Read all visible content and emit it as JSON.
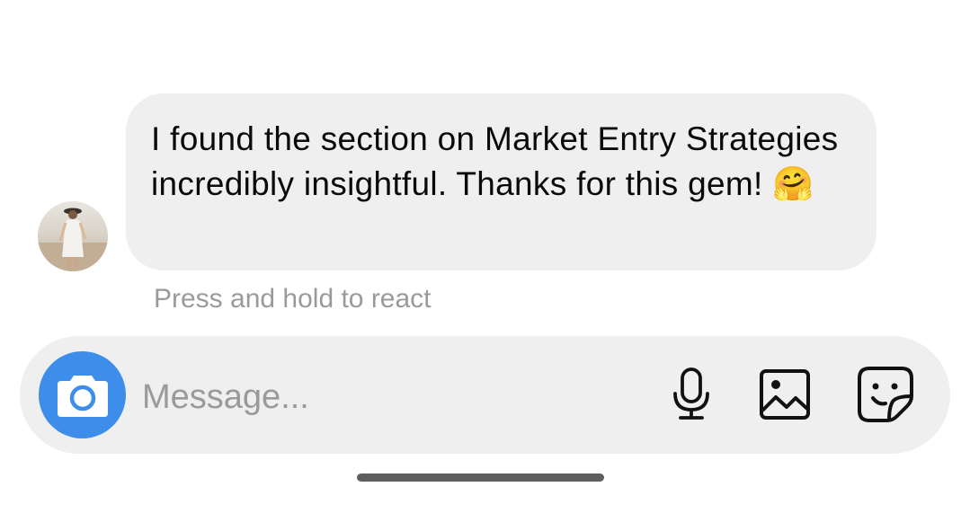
{
  "conversation": {
    "message": {
      "text": "I found the section on Market Entry Strategies incredibly insightful. Thanks for this gem!",
      "emoji": "🤗"
    },
    "hint": "Press and hold to react"
  },
  "composer": {
    "placeholder": "Message...",
    "icons": [
      "camera-icon",
      "microphone-icon",
      "photo-icon",
      "sticker-icon"
    ]
  },
  "colors": {
    "camera_button": "#3d8eea",
    "bubble": "#efefef",
    "composer": "#efefef",
    "hint_text": "#9a9a9a"
  }
}
